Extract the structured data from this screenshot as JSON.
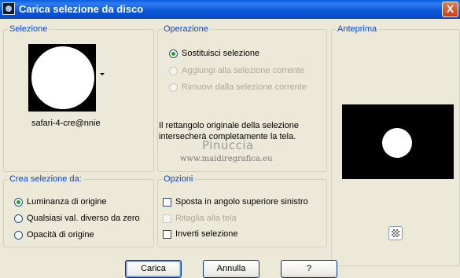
{
  "window": {
    "title": "Carica selezione da disco",
    "close_label": "X"
  },
  "selezione": {
    "legend": "Selezione",
    "name": "safari-4-cre@nnie"
  },
  "operazione": {
    "legend": "Operazione",
    "options": [
      {
        "label": "Sostituisci selezione",
        "checked": true,
        "enabled": true
      },
      {
        "label": "Aggiungi alla selezione corrente",
        "checked": false,
        "enabled": false
      },
      {
        "label": "Rimuovi dalla selezione corrente",
        "checked": false,
        "enabled": false
      }
    ],
    "info_line1": "Il rettangolo originale della selezione",
    "info_line2": "intersecherà completamente la tela."
  },
  "watermark": {
    "name": "Pinuccia",
    "url": "www.maidiregrafica.eu"
  },
  "anteprima": {
    "legend": "Anteprima"
  },
  "crea": {
    "legend": "Crea selezione da:",
    "options": [
      {
        "label": "Luminanza di origine",
        "checked": true
      },
      {
        "label": "Qualsiasi val. diverso da zero",
        "checked": false
      },
      {
        "label": "Opacità di origine",
        "checked": false
      }
    ]
  },
  "opzioni": {
    "legend": "Opzioni",
    "items": [
      {
        "label": "Sposta in angolo superiore sinistro",
        "checked": false,
        "enabled": true
      },
      {
        "label": "Ritaglia alla tela",
        "checked": false,
        "enabled": false
      },
      {
        "label": "Inverti selezione",
        "checked": false,
        "enabled": true
      }
    ]
  },
  "buttons": {
    "load": "Carica",
    "cancel": "Annulla",
    "help": "?"
  }
}
